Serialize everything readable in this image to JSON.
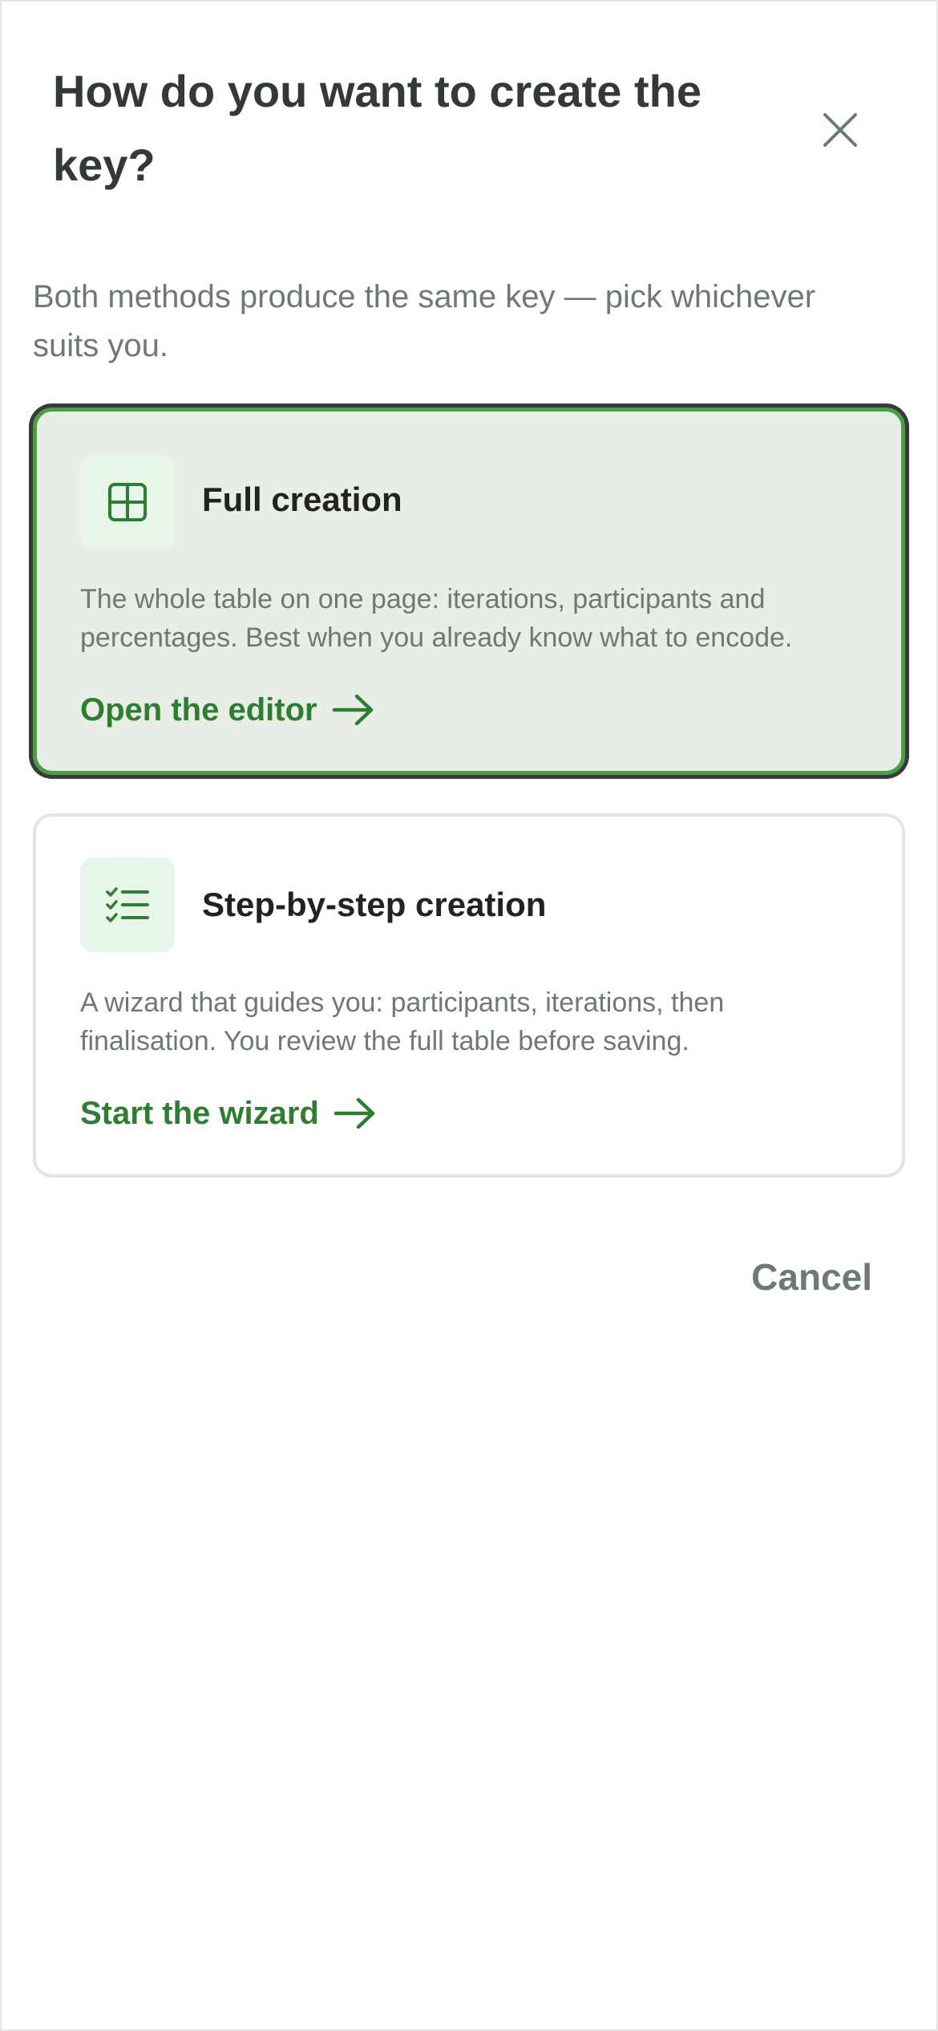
{
  "dialog": {
    "title": "How do you want to create the key?",
    "subtitle": "Both methods produce the same key — pick whichever suits you.",
    "close_icon": "close-icon",
    "cancel_label": "Cancel"
  },
  "options": [
    {
      "title": "Full creation",
      "description": "The whole table on one page: iterations, participants and percentages. Best when you already know what to encode.",
      "action_label": "Open the editor",
      "icon": "table-grid-icon",
      "selected": true
    },
    {
      "title": "Step-by-step creation",
      "description": "A wizard that guides you: participants, iterations, then finalisation. You review the full table before saving.",
      "action_label": "Start the wizard",
      "icon": "checklist-icon",
      "selected": false
    }
  ],
  "colors": {
    "accent": "#2e7d32",
    "selected_border": "#4a9f45",
    "selected_background": "#e8eee5",
    "muted_text": "#6c7a71"
  }
}
